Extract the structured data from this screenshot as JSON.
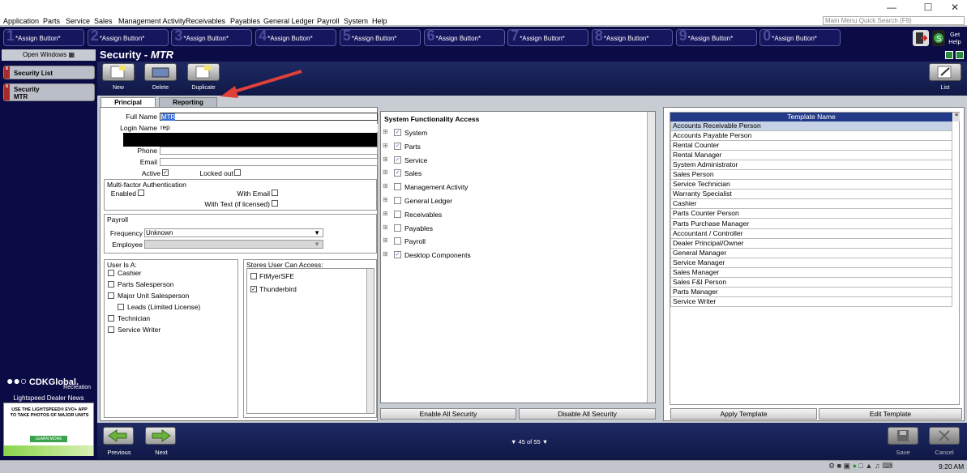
{
  "menu": [
    "Application",
    "Parts",
    "Service",
    "Sales",
    "Management Activity",
    "Receivables",
    "Payables",
    "General Ledger",
    "Payroll",
    "System",
    "Help"
  ],
  "quick_search_placeholder": "Main Menu Quick Search (F9)",
  "assign_buttons": [
    {
      "num": "1",
      "label": "*Assign Button*"
    },
    {
      "num": "2",
      "label": "*Assign Button*"
    },
    {
      "num": "3",
      "label": "*Assign Button*"
    },
    {
      "num": "4",
      "label": "*Assign Button*"
    },
    {
      "num": "5",
      "label": "*Assign Button*"
    },
    {
      "num": "6",
      "label": "*Assign Button*"
    },
    {
      "num": "7",
      "label": "*Assign Button*"
    },
    {
      "num": "8",
      "label": "*Assign Button*"
    },
    {
      "num": "9",
      "label": "*Assign Button*"
    },
    {
      "num": "0",
      "label": "*Assign Button*"
    }
  ],
  "get_help": "Get Help",
  "sidebar": {
    "title": "Open Windows",
    "items": [
      "Security List",
      "Security\nMTR"
    ],
    "brand": "CDKGlobal.",
    "brand_sub": "Recreation",
    "news": "Lightspeed Dealer News",
    "ad_text": "USE THE LIGHTSPEED® EVO+ APP TO TAKE PHOTOS OF MAJOR UNITS",
    "ad_button": "LEARN MORE"
  },
  "window": {
    "title": "Security",
    "subtitle": "MTR"
  },
  "toolbar": {
    "new": "New",
    "delete": "Delete",
    "duplicate": "Duplicate",
    "list": "List"
  },
  "tabs": [
    "Principal",
    "Reporting"
  ],
  "form": {
    "full_name_label": "Full Name",
    "full_name": "MTR",
    "login_label": "Login Name",
    "login": "rep",
    "phone_label": "Phone",
    "email_label": "Email",
    "active_label": "Active",
    "locked_label": "Locked out"
  },
  "mfa": {
    "title": "Multi-factor Authentication",
    "enabled": "Enabled",
    "with_email": "With Email",
    "with_text": "With Text (if licensed)"
  },
  "payroll": {
    "title": "Payroll",
    "frequency_label": "Frequency",
    "frequency": "Unknown",
    "employee_label": "Employee"
  },
  "user_is": {
    "title": "User Is A:",
    "items": [
      "Cashier",
      "Parts Salesperson",
      "Major Unit Salesperson",
      "Leads (Limited License)",
      "Technician",
      "Service Writer"
    ]
  },
  "stores": {
    "title": "Stores User Can Access:",
    "items": [
      {
        "label": "FtMyerSFE",
        "checked": false
      },
      {
        "label": "Thunderbird",
        "checked": true
      }
    ]
  },
  "sfa": {
    "title": "System Functionality Access",
    "items": [
      {
        "label": "System",
        "checked": true
      },
      {
        "label": "Parts",
        "checked": true
      },
      {
        "label": "Service",
        "checked": true
      },
      {
        "label": "Sales",
        "checked": true
      },
      {
        "label": "Management Activity",
        "checked": false
      },
      {
        "label": "General Ledger",
        "checked": false
      },
      {
        "label": "Receivables",
        "checked": false
      },
      {
        "label": "Payables",
        "checked": false
      },
      {
        "label": "Payroll",
        "checked": false
      },
      {
        "label": "Desktop Components",
        "checked": true
      }
    ],
    "enable_all": "Enable All Security",
    "disable_all": "Disable All Security"
  },
  "templates": {
    "header": "Template Name",
    "rows": [
      "Accounts Receivable Person",
      "Accounts Payable Person",
      "Rental Counter",
      "Rental Manager",
      "System Administrator",
      "Sales Person",
      "Service Technician",
      "Warranty Specialist",
      "Cashier",
      "Parts Counter Person",
      "Parts Purchase Manager",
      "Accountant / Controller",
      "Dealer Principal/Owner",
      "General Manager",
      "Service Manager",
      "Sales Manager",
      "Sales F&I Person",
      "Parts Manager",
      "Service Writer"
    ],
    "apply": "Apply Template",
    "edit": "Edit Template"
  },
  "footer": {
    "previous": "Previous",
    "next": "Next",
    "record": "45",
    "of": "of",
    "total": "55",
    "save": "Save",
    "cancel": "Cancel"
  },
  "taskbar": {
    "time": "9:20 AM"
  }
}
